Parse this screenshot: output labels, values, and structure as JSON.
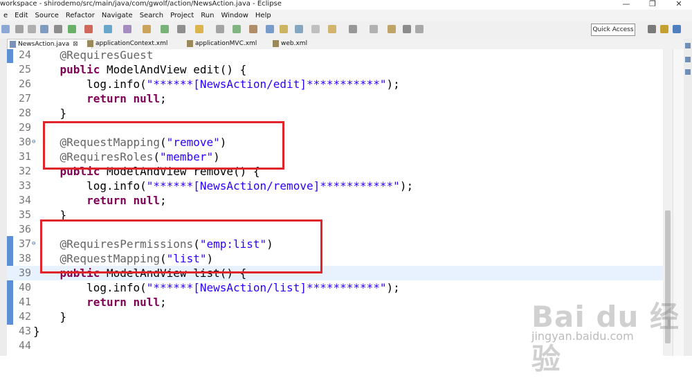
{
  "window": {
    "title": "workspace - shirodemo/src/main/java/com/gwolf/action/NewsAction.java - Eclipse"
  },
  "menu": [
    "e",
    "Edit",
    "Source",
    "Refactor",
    "Navigate",
    "Search",
    "Project",
    "Run",
    "Window",
    "Help"
  ],
  "toolbar": {
    "quick_access": "Quick Access"
  },
  "tabs": [
    {
      "label": "NewsAction.java",
      "close": "⊠",
      "active": true
    },
    {
      "label": "applicationContext.xml",
      "active": false
    },
    {
      "label": "applicationMVC.xml",
      "active": false
    },
    {
      "label": "web.xml",
      "active": false
    }
  ],
  "editor": {
    "lines": [
      {
        "n": "24",
        "text": "    @RequiresGuest"
      },
      {
        "n": "25",
        "text": "    public ModelAndView edit() {"
      },
      {
        "n": "26",
        "text": "        log.info(\"******[NewsAction/edit]***********\");"
      },
      {
        "n": "27",
        "text": "        return null;"
      },
      {
        "n": "28",
        "text": "    }"
      },
      {
        "n": "29",
        "text": ""
      },
      {
        "n": "30",
        "text": "    @RequestMapping(\"remove\")",
        "fold": true
      },
      {
        "n": "31",
        "text": "    @RequiresRoles(\"member\")"
      },
      {
        "n": "32",
        "text": "    public ModelAndView remove() {"
      },
      {
        "n": "33",
        "text": "        log.info(\"******[NewsAction/remove]***********\");"
      },
      {
        "n": "34",
        "text": "        return null;"
      },
      {
        "n": "35",
        "text": "    }"
      },
      {
        "n": "36",
        "text": ""
      },
      {
        "n": "37",
        "text": "    @RequiresPermissions(\"emp:list\")",
        "fold": true
      },
      {
        "n": "38",
        "text": "    @RequestMapping(\"list\")"
      },
      {
        "n": "39",
        "text": "    public ModelAndView list() {",
        "highlight": true
      },
      {
        "n": "40",
        "text": "        log.info(\"******[NewsAction/list]***********\");"
      },
      {
        "n": "41",
        "text": "        return null;"
      },
      {
        "n": "42",
        "text": "    }"
      },
      {
        "n": "43",
        "text": "}"
      },
      {
        "n": "44",
        "text": ""
      }
    ]
  },
  "watermark": {
    "logo": "Bai du 经验",
    "url": "jingyan.baidu.com"
  }
}
